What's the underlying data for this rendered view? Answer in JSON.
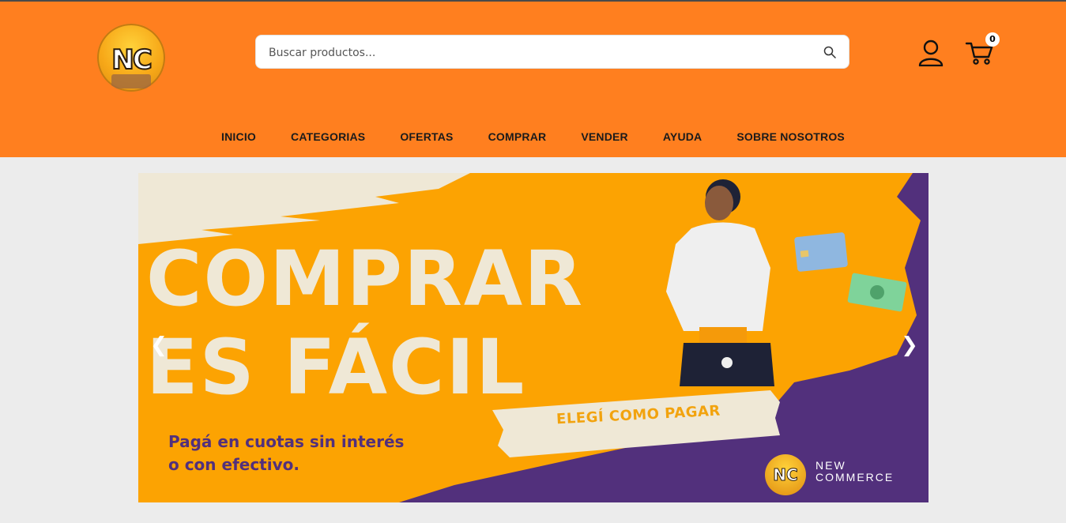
{
  "header": {
    "logo_text": "NC",
    "search": {
      "placeholder": "Buscar productos..."
    },
    "cart": {
      "count": "0"
    }
  },
  "nav": {
    "items": [
      "INICIO",
      "CATEGORIAS",
      "OFERTAS",
      "COMPRAR",
      "VENDER",
      "AYUDA",
      "SOBRE NOSOTROS"
    ]
  },
  "banner": {
    "headline_line1": "COMPRAR",
    "headline_line2": "ES FÁCIL",
    "subtitle_line1": "Pagá en cuotas sin interés",
    "subtitle_line2": "o con efectivo.",
    "cta": "ELEGÍ COMO PAGAR",
    "brand_line1": "NEW",
    "brand_line2": "COMMERCE",
    "prev_arrow": "❮",
    "next_arrow": "❯"
  },
  "colors": {
    "header_bg": "#ff7f1f",
    "banner_bg": "#fca302",
    "banner_purple": "#52307c",
    "banner_cream": "#efe8d6"
  }
}
